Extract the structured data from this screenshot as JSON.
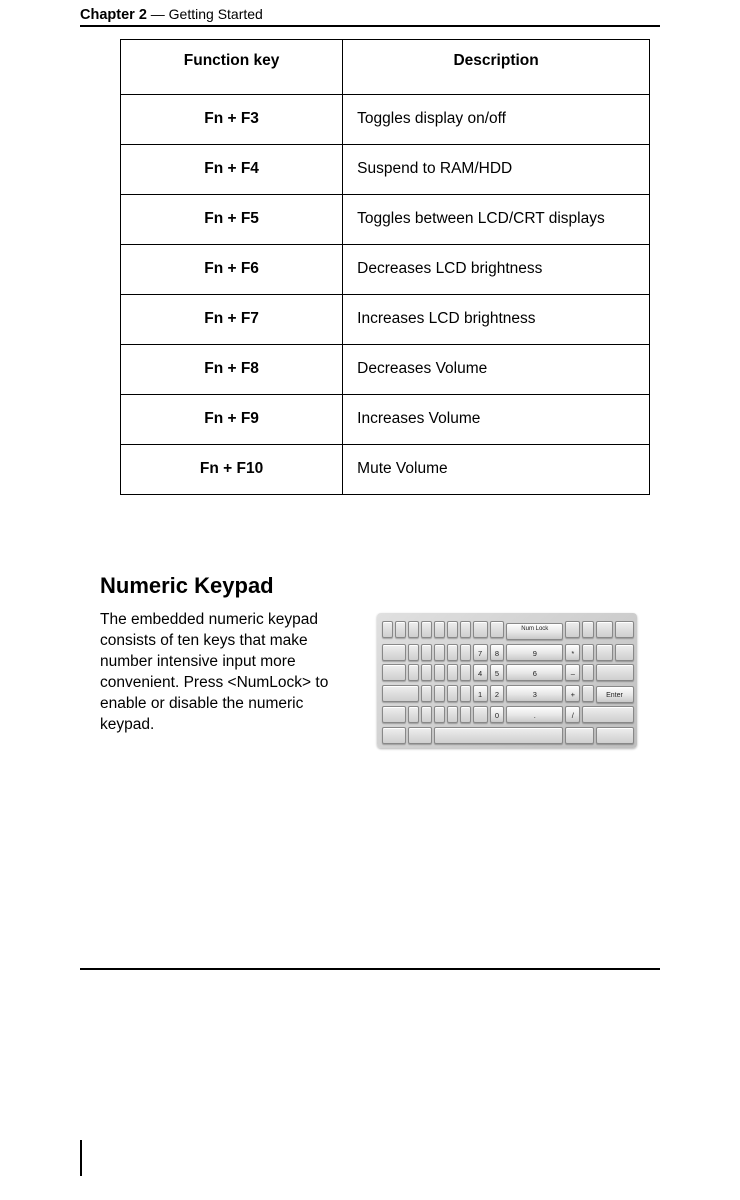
{
  "header": {
    "chapter_label": "Chapter 2",
    "separator": " — ",
    "chapter_title": "Getting Started"
  },
  "fn_table": {
    "headers": {
      "key": "Function key",
      "desc": "Description"
    },
    "rows": [
      {
        "key": "Fn + F3",
        "desc": "Toggles display on/off"
      },
      {
        "key": "Fn + F4",
        "desc": "Suspend to RAM/HDD"
      },
      {
        "key": "Fn + F5",
        "desc": "Toggles between LCD/CRT displays"
      },
      {
        "key": "Fn + F6",
        "desc": "Decreases LCD brightness"
      },
      {
        "key": "Fn + F7",
        "desc": "Increases LCD brightness"
      },
      {
        "key": "Fn + F8",
        "desc": "Decreases Volume"
      },
      {
        "key": "Fn + F9",
        "desc": "Increases Volume"
      },
      {
        "key": "Fn + F10",
        "desc": "Mute Volume"
      }
    ]
  },
  "section": {
    "title": "Numeric Keypad",
    "body": "The embedded numeric keypad consists of ten keys that make number intensive input more convenient. Press <NumLock> to enable or disable the numeric keypad."
  },
  "keypad": {
    "labels": {
      "numlock": "Num Lock",
      "7": "7",
      "8": "8",
      "9": "9",
      "star": "*",
      "4": "4",
      "5": "5",
      "6": "6",
      "minus": "–",
      "1": "1",
      "2": "2",
      "3": "3",
      "plus": "+",
      "enter": "Enter",
      "0": "0",
      "dot": ".",
      "slash": "/"
    }
  }
}
